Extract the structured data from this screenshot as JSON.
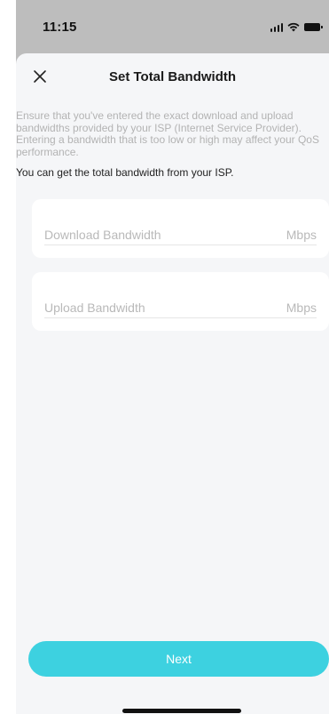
{
  "status_bar": {
    "time": "11:15"
  },
  "header": {
    "title": "Set Total Bandwidth"
  },
  "description": "Ensure that you've entered the exact download and upload bandwidths provided by your ISP (Internet Service Provider). Entering a bandwidth that is too low or high may affect your QoS performance.",
  "note": "You can get the total bandwidth from your ISP.",
  "fields": {
    "download": {
      "placeholder": "Download Bandwidth",
      "unit": "Mbps"
    },
    "upload": {
      "placeholder": "Upload Bandwidth",
      "unit": "Mbps"
    }
  },
  "actions": {
    "next_label": "Next"
  },
  "colors": {
    "accent": "#3dd1e0",
    "sheet_bg": "#f5f6f8"
  },
  "icons": {
    "close": "close-icon",
    "signal": "cellular-signal-icon",
    "wifi": "wifi-icon",
    "battery": "battery-icon"
  }
}
